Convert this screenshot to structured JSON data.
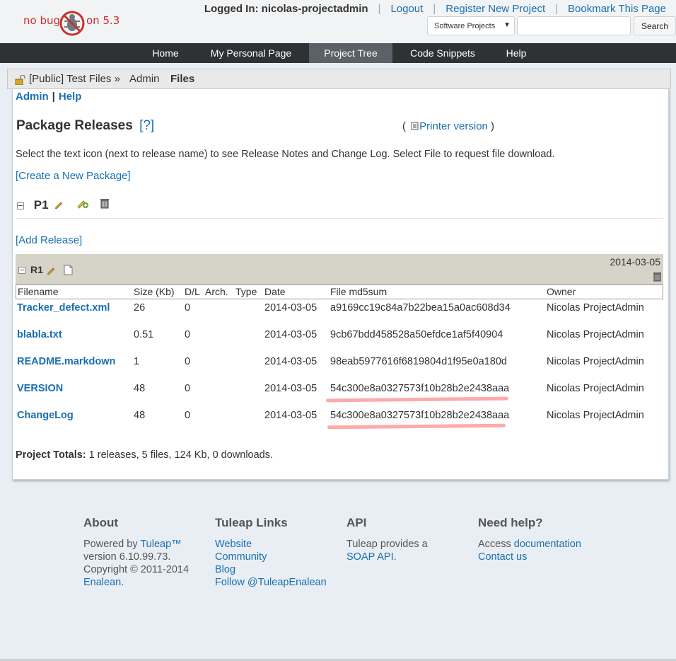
{
  "logo": {
    "left_text": "no bug",
    "right_text": "on 5.3"
  },
  "header": {
    "logged_in": "Logged In: nicolas-projectadmin",
    "links": [
      "Logout",
      "Register New Project",
      "Bookmark This Page"
    ],
    "project_select": "Software Projects",
    "search_button": "Search",
    "search_value": ""
  },
  "nav": {
    "items": [
      "Home",
      "My Personal Page",
      "Project Tree",
      "Code Snippets",
      "Help"
    ],
    "active": "Project Tree"
  },
  "breadcrumb": {
    "project": "[Public] Test Files »",
    "admin": "Admin",
    "current": "Files"
  },
  "subnav": {
    "admin": "Admin",
    "separator": "|",
    "help": "Help"
  },
  "page": {
    "title": "Package Releases",
    "help_link": "[?]",
    "printer_open": "(",
    "printer_link": "Printer version",
    "printer_close": ")",
    "intro": "Select the text icon (next to release name) to see Release Notes and Change Log. Select File to request file download.",
    "create_package": "[Create a New Package]",
    "add_release": "[Add Release]"
  },
  "package": {
    "name": "P1"
  },
  "release": {
    "name": "R1",
    "date": "2014-03-05"
  },
  "table": {
    "headers": [
      "Filename",
      "Size (Kb)",
      "D/L",
      "Arch.",
      "Type",
      "Date",
      "File md5sum",
      "Owner"
    ],
    "rows": [
      {
        "filename": "Tracker_defect.xml",
        "size": "26",
        "dl": "0",
        "date": "2014-03-05",
        "md5": "a9169cc19c84a7b22bea15a0ac608d34",
        "owner": "Nicolas ProjectAdmin"
      },
      {
        "filename": "blabla.txt",
        "size": "0.51",
        "dl": "0",
        "date": "2014-03-05",
        "md5": "9cb67bdd458528a50efdce1af5f40904",
        "owner": "Nicolas ProjectAdmin"
      },
      {
        "filename": "README.markdown",
        "size": "1",
        "dl": "0",
        "date": "2014-03-05",
        "md5": "98eab5977616f6819804d1f95e0a180d",
        "owner": "Nicolas ProjectAdmin"
      },
      {
        "filename": "VERSION",
        "size": "48",
        "dl": "0",
        "date": "2014-03-05",
        "md5": "54c300e8a0327573f10b28b2e2438aaa",
        "owner": "Nicolas ProjectAdmin"
      },
      {
        "filename": "ChangeLog",
        "size": "48",
        "dl": "0",
        "date": "2014-03-05",
        "md5": "54c300e8a0327573f10b28b2e2438aaa",
        "owner": "Nicolas ProjectAdmin"
      }
    ]
  },
  "totals": {
    "label": "Project Totals:",
    "text": "1 releases, 5 files, 124 Kb, 0 downloads."
  },
  "footer": {
    "about": {
      "title": "About",
      "powered": "Powered by",
      "tuleap": "Tuleap™",
      "version": "version 6.10.99.73.",
      "copyright": "Copyright © 2011-2014",
      "enalean": "Enalean."
    },
    "links": {
      "title": "Tuleap Links",
      "items": [
        "Website",
        "Community",
        "Blog",
        "Follow @TuleapEnalean"
      ]
    },
    "api": {
      "title": "API",
      "text": "Tuleap provides a",
      "link": "SOAP API."
    },
    "help": {
      "title": "Need help?",
      "access": "Access",
      "doc": "documentation",
      "contact": "Contact us"
    }
  },
  "colors": {
    "link": "#1a6fb0",
    "nav_bg": "#2f3235",
    "nav_active": "#5b6166",
    "release_bar": "#d6d3c8",
    "annotation": "#ff8d8d"
  }
}
